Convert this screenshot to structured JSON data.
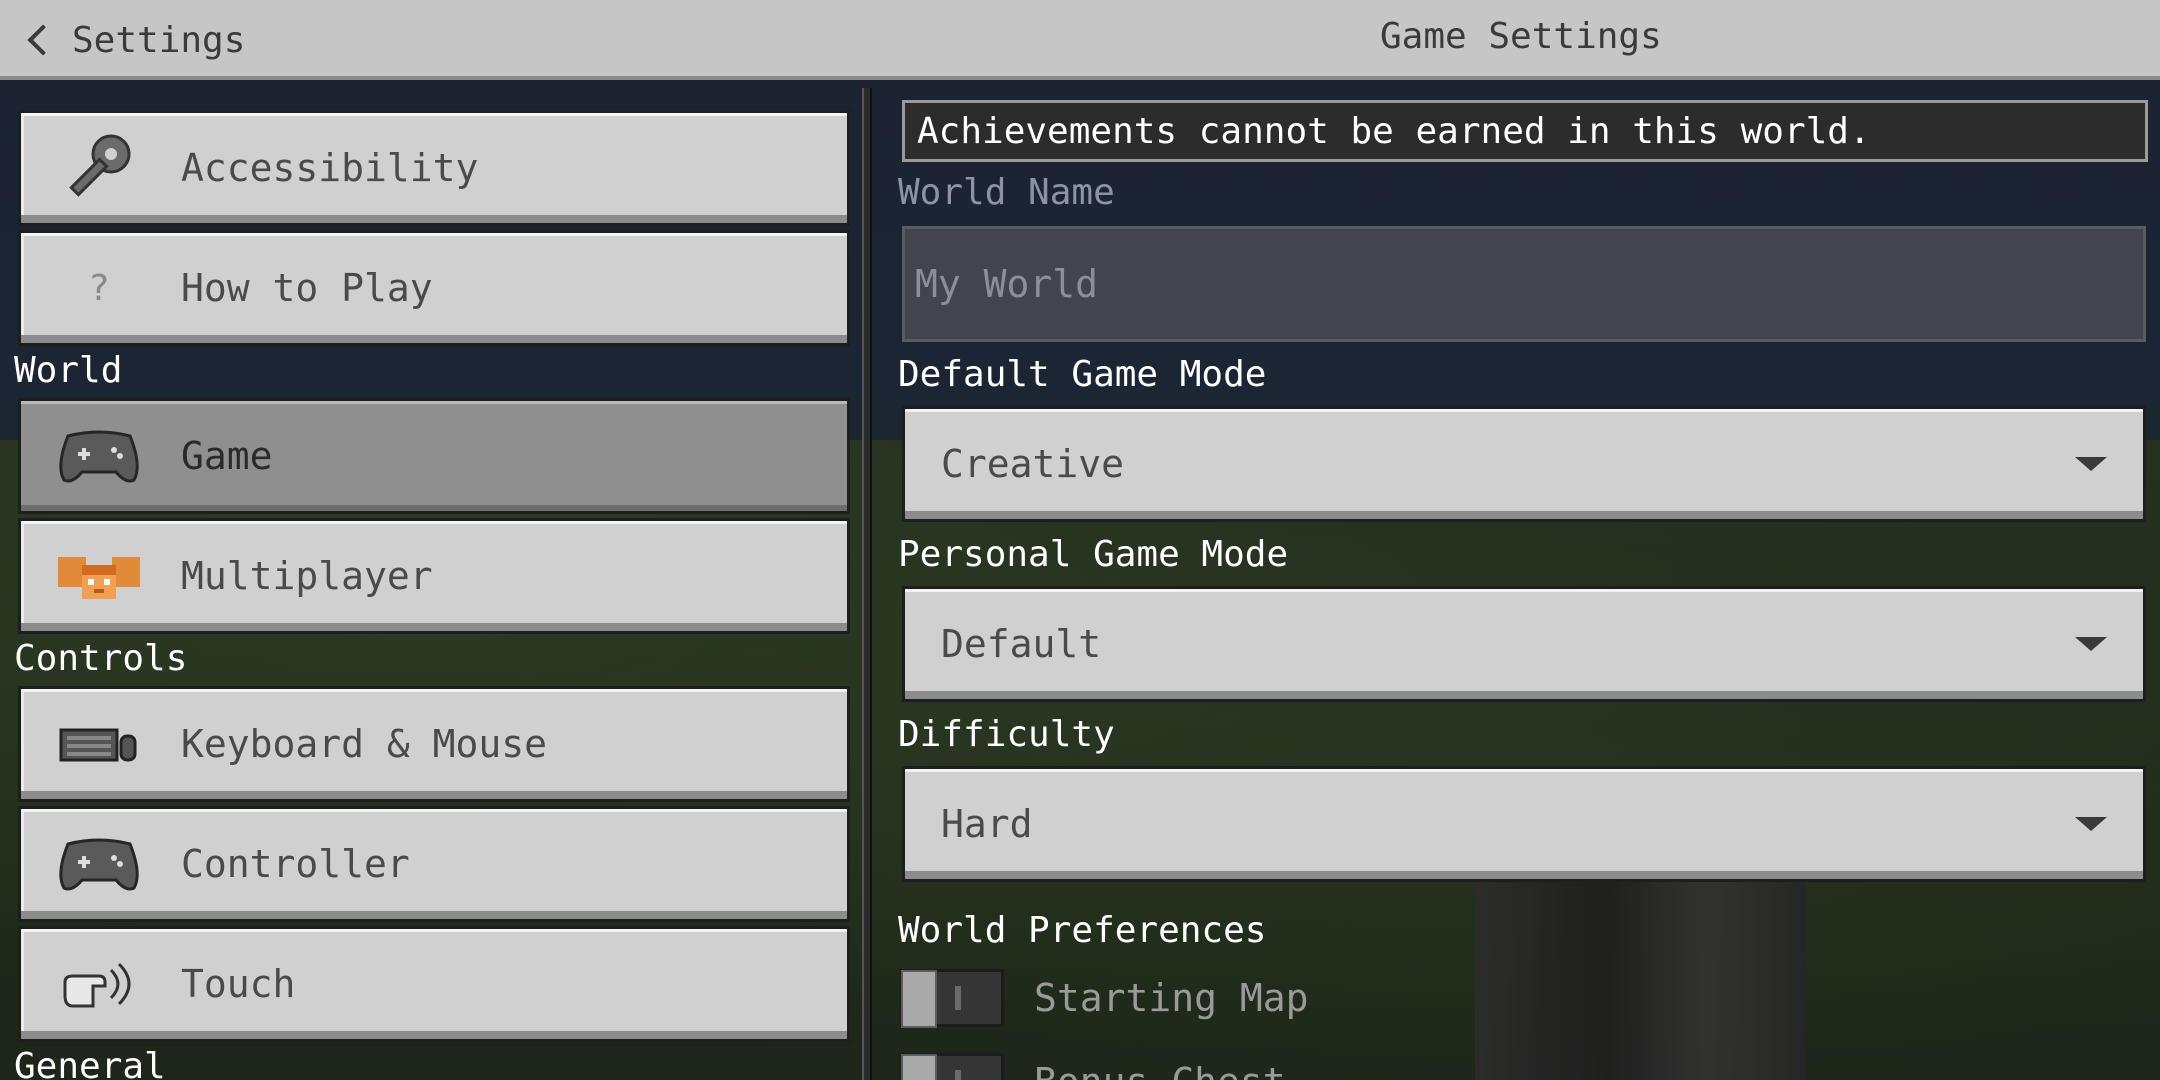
{
  "header": {
    "back_label": "Settings",
    "title": "Game Settings"
  },
  "sidebar": {
    "items_top": [
      {
        "label": "Accessibility",
        "icon": "key-icon"
      },
      {
        "label": "How to Play",
        "icon": "question-icon",
        "icon_glyph": "?"
      }
    ],
    "sections": [
      {
        "label": "World",
        "items": [
          {
            "label": "Game",
            "icon": "controller-icon",
            "selected": true
          },
          {
            "label": "Multiplayer",
            "icon": "players-icon"
          }
        ]
      },
      {
        "label": "Controls",
        "items": [
          {
            "label": "Keyboard & Mouse",
            "icon": "keyboard-mouse-icon"
          },
          {
            "label": "Controller",
            "icon": "controller-icon"
          },
          {
            "label": "Touch",
            "icon": "touch-hand-icon"
          }
        ]
      },
      {
        "label": "General",
        "items": []
      }
    ]
  },
  "panel": {
    "banner": "Achievements cannot be earned in this world.",
    "world_name": {
      "label": "World Name",
      "value": "My World"
    },
    "default_game_mode": {
      "label": "Default Game Mode",
      "value": "Creative"
    },
    "personal_game_mode": {
      "label": "Personal Game Mode",
      "value": "Default"
    },
    "difficulty": {
      "label": "Difficulty",
      "value": "Hard"
    },
    "world_preferences": {
      "label": "World Preferences",
      "toggles": [
        {
          "label": "Starting Map",
          "on": false
        },
        {
          "label": "Bonus Chest",
          "on": false
        }
      ]
    }
  },
  "colors": {
    "header_bg": "#c6c6c6",
    "button_bg": "#d0d0d0",
    "button_selected_bg": "#8f8f8f",
    "text_white": "#ffffff"
  }
}
